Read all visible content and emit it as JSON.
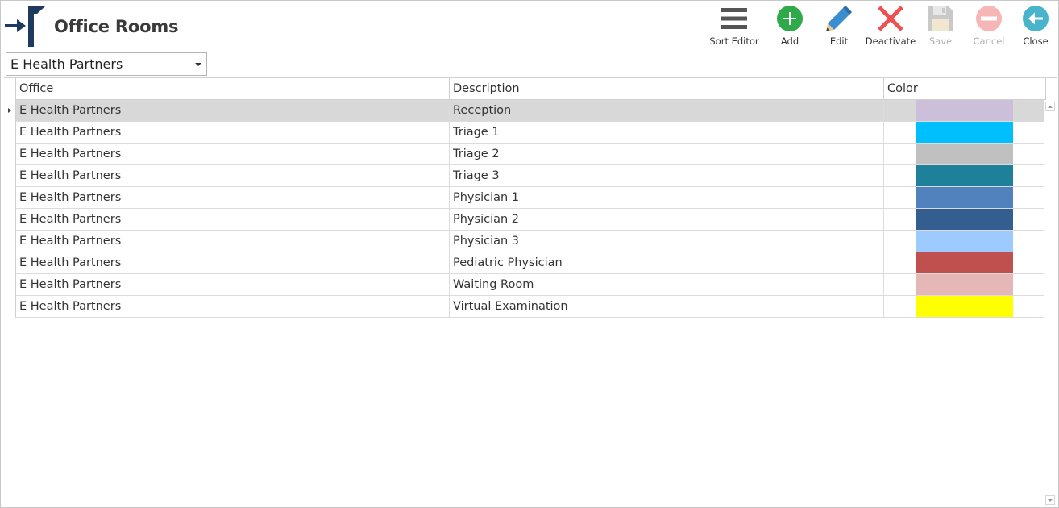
{
  "window": {
    "title": "Office Rooms"
  },
  "toolbar": {
    "sort_editor": "Sort Editor",
    "add": "Add",
    "edit": "Edit",
    "deactivate": "Deactivate",
    "save": "Save",
    "cancel": "Cancel",
    "close": "Close"
  },
  "icons": {
    "logo": "entry-arrow-logo-icon",
    "sort_editor": "hamburger-menu-icon",
    "add": "plus-circle-icon",
    "edit": "pencil-icon",
    "deactivate": "red-x-icon",
    "save": "floppy-disk-icon",
    "cancel": "minus-circle-icon",
    "close": "back-arrow-circle-icon"
  },
  "colors": {
    "brand": "#1f3a5f",
    "add_green": "#2eaa4b",
    "edit_blue": "#3b8fd0",
    "deactivate_red": "#f05050",
    "close_teal": "#48b4cc",
    "disabled": "#c8c8c8",
    "selected_row": "#d8d8d8"
  },
  "office_filter": {
    "selected": "E Health Partners"
  },
  "grid": {
    "columns": {
      "office": "Office",
      "description": "Description",
      "color": "Color"
    },
    "rows": [
      {
        "office": "E Health Partners",
        "description": "Reception",
        "color": "#ccbfd9"
      },
      {
        "office": "E Health Partners",
        "description": "Triage 1",
        "color": "#00bfff"
      },
      {
        "office": "E Health Partners",
        "description": "Triage 2",
        "color": "#c0c0c0"
      },
      {
        "office": "E Health Partners",
        "description": "Triage 3",
        "color": "#1e8199"
      },
      {
        "office": "E Health Partners",
        "description": "Physician 1",
        "color": "#5182bd"
      },
      {
        "office": "E Health Partners",
        "description": "Physician 2",
        "color": "#345e8f"
      },
      {
        "office": "E Health Partners",
        "description": "Physician 3",
        "color": "#9ecbff"
      },
      {
        "office": "E Health Partners",
        "description": "Pediatric Physician",
        "color": "#c0504d"
      },
      {
        "office": "E Health Partners",
        "description": "Waiting Room",
        "color": "#e5b7b6"
      },
      {
        "office": "E Health Partners",
        "description": "Virtual Examination",
        "color": "#ffff00"
      }
    ]
  }
}
